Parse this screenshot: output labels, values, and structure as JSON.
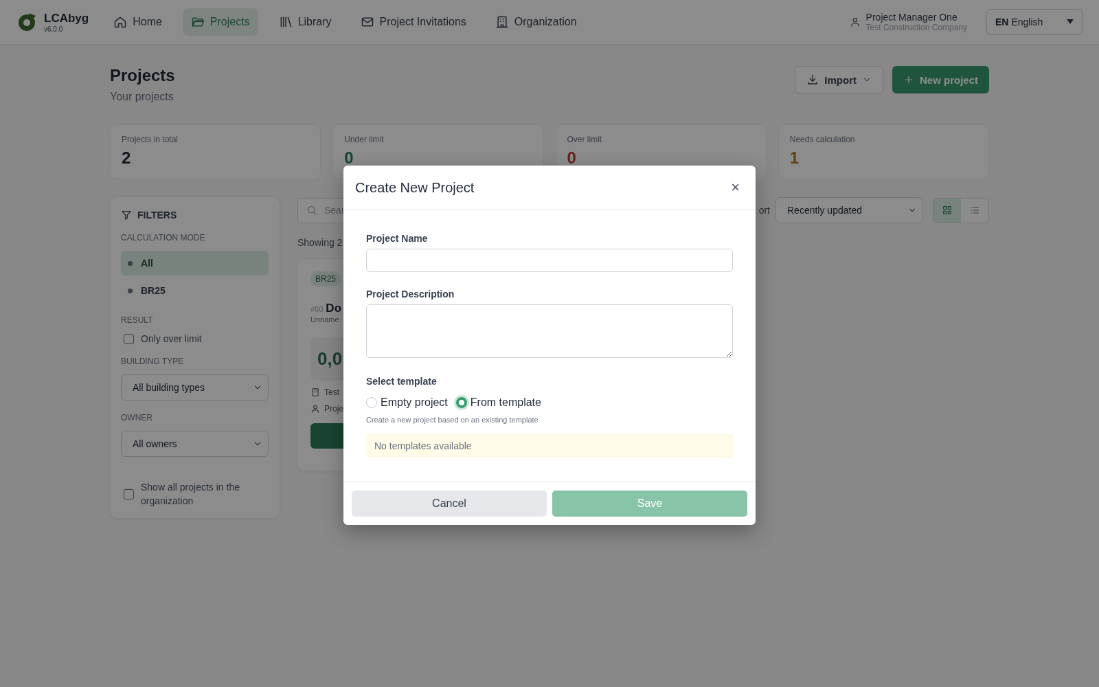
{
  "header": {
    "logo": {
      "name": "LCAbyg",
      "version": "v6.0.0"
    },
    "nav": [
      {
        "label": "Home",
        "kind": "home",
        "selected": false
      },
      {
        "label": "Projects",
        "kind": "folder",
        "selected": true
      },
      {
        "label": "Library",
        "kind": "library",
        "selected": false
      },
      {
        "label": "Project Invitations",
        "kind": "mail",
        "selected": false
      },
      {
        "label": "Organization",
        "kind": "building",
        "selected": false
      }
    ],
    "user": {
      "name": "Project Manager One",
      "company": "Test Construction Company"
    },
    "language": {
      "code": "EN",
      "label": "English"
    }
  },
  "page": {
    "title": "Projects",
    "subtitle": "Your projects",
    "import_button": "Import",
    "new_button": "New project"
  },
  "stats": [
    {
      "label": "Projects in total",
      "value": "2",
      "kind": "total"
    },
    {
      "label": "Under limit",
      "value": "0",
      "kind": "under"
    },
    {
      "label": "Over limit",
      "value": "0",
      "kind": "over"
    },
    {
      "label": "Needs calculation",
      "value": "1",
      "kind": "pending"
    }
  ],
  "filters": {
    "title": "FILTERS",
    "mode_heading": "CALCULATION MODE",
    "modes": [
      {
        "label": "All",
        "selected": true
      },
      {
        "label": "BR25",
        "selected": false
      }
    ],
    "result_heading": "RESULT",
    "only_over_limit": {
      "label": "Only over limit",
      "checked": false
    },
    "building_heading": "BUILDING TYPE",
    "building_value": "All building types",
    "owner_heading": "OWNER",
    "owner_value": "All owners",
    "show_all": {
      "label": "Show all projects in the organization",
      "checked": false
    }
  },
  "toolbar": {
    "search_placeholder": "Sear",
    "sort_label": "ort",
    "sort_value": "Recently updated",
    "views": [
      {
        "kind": "grid",
        "selected": true
      },
      {
        "kind": "list",
        "selected": false
      }
    ]
  },
  "showing": "Showing 2",
  "card": {
    "badge": "BR25",
    "number": "#60",
    "name": "Do",
    "subtitle": "Unname",
    "value": "0,0",
    "organization": "Test",
    "owner": "Proje"
  },
  "modal": {
    "title": "Create New Project",
    "close": "×",
    "name_label": "Project Name",
    "description_label": "Project Description",
    "template_heading": "Select template",
    "template_options": [
      {
        "label": "Empty project",
        "selected": false
      },
      {
        "label": "From template",
        "selected": true
      }
    ],
    "hint": "Create a new project based on an existing template",
    "notice": "No templates available",
    "cancel": "Cancel",
    "save": "Save",
    "save_disabled": true
  }
}
